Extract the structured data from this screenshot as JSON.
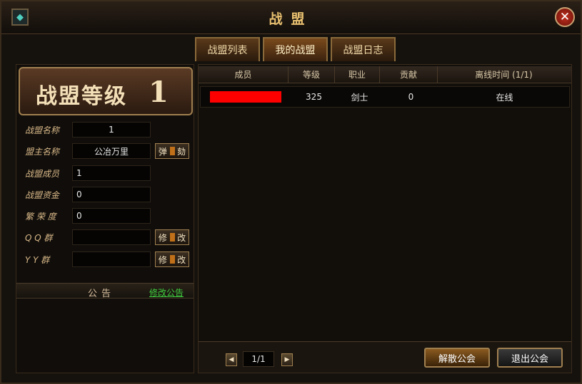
{
  "window": {
    "title": "战盟",
    "close_icon": "✕"
  },
  "tabs": [
    {
      "label": "战盟列表"
    },
    {
      "label": "我的战盟"
    },
    {
      "label": "战盟日志"
    }
  ],
  "guild": {
    "level_label": "战盟等级",
    "level_value": "1",
    "fields": [
      {
        "label": "战盟名称",
        "value": "1"
      },
      {
        "label": "盟主名称",
        "value": "公冶万里",
        "button": "弹劾"
      },
      {
        "label": "战盟成员",
        "value": "1"
      },
      {
        "label": "战盟资金",
        "value": "0"
      },
      {
        "label": "繁 荣 度",
        "value": "0"
      },
      {
        "label": "Q Q  群",
        "value": "",
        "button": "修改"
      },
      {
        "label": "Y Y  群",
        "value": "",
        "button": "修改"
      }
    ],
    "notice_title": "公告",
    "notice_edit_link": "修改公告"
  },
  "members": {
    "columns": [
      "成员",
      "等级",
      "职业",
      "贡献",
      "离线时间 (1/1)"
    ],
    "rows": [
      {
        "name": "",
        "level": "325",
        "class": "剑士",
        "contribution": "0",
        "status": "在线"
      }
    ]
  },
  "pagination": {
    "page": "1/1",
    "prev_icon": "◀",
    "next_icon": "▶"
  },
  "actions": {
    "disband": "解散公会",
    "leave": "退出公会"
  },
  "colors": {
    "name_redaction": "#ff0000",
    "link": "#40d040",
    "accent_gold": "#e8c070"
  }
}
